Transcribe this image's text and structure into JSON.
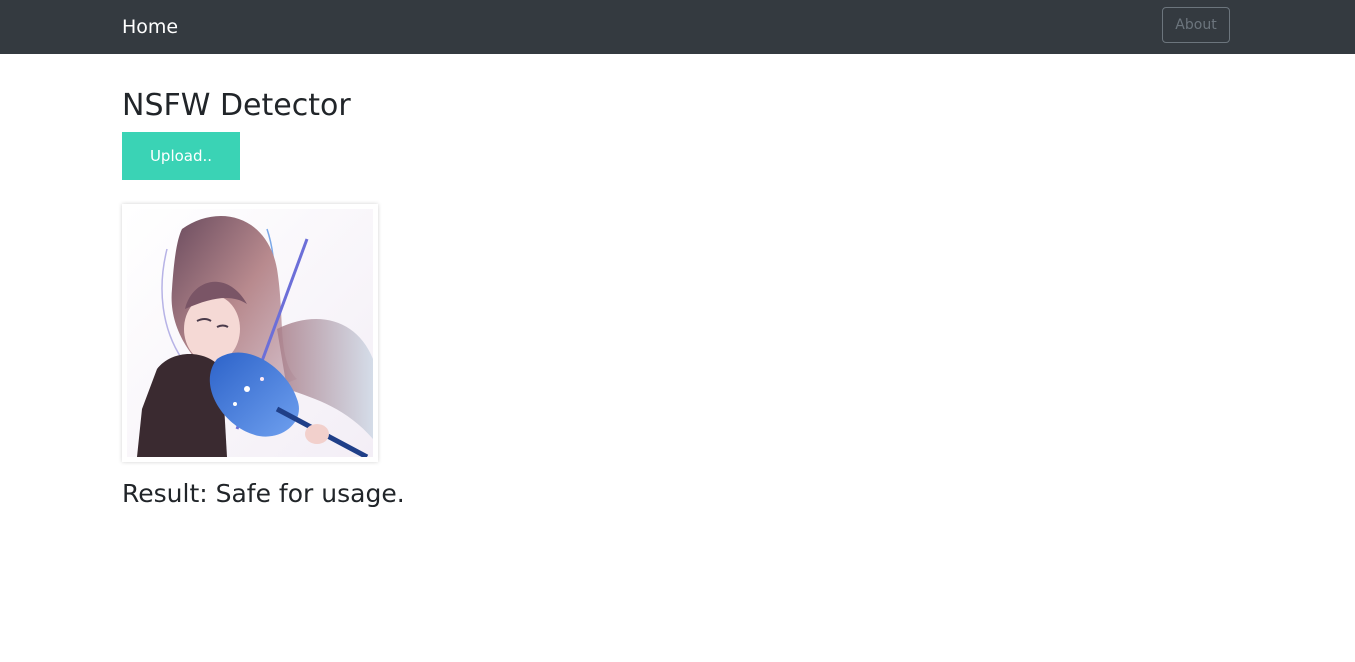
{
  "navbar": {
    "brand_label": "Home",
    "about_label": "About"
  },
  "main": {
    "title": "NSFW Detector",
    "upload_label": "Upload..",
    "result_text": "Result: Safe for usage."
  },
  "colors": {
    "navbar_bg": "#343a40",
    "upload_button": "#3ad3b5",
    "about_border": "#6c757d"
  }
}
